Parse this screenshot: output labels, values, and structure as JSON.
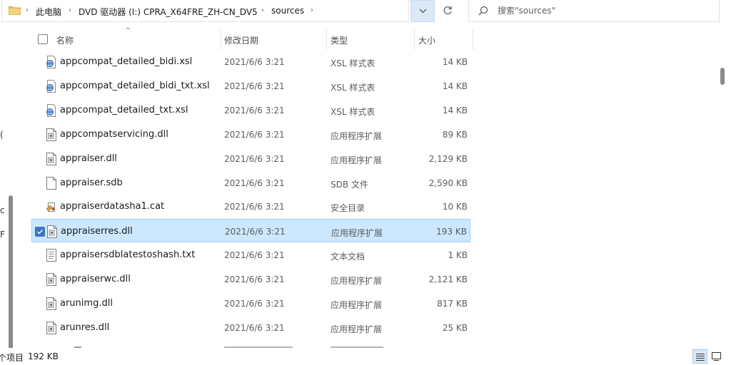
{
  "breadcrumb": {
    "items": [
      "此电脑",
      "DVD 驱动器 (I:) CPRA_X64FRE_ZH-CN_DV5",
      "sources"
    ]
  },
  "search": {
    "placeholder": "搜索\"sources\""
  },
  "nav_fragments": [
    "(",
    "c",
    "F"
  ],
  "columns": {
    "name": "名称",
    "date": "修改日期",
    "type": "类型",
    "size": "大小"
  },
  "files": [
    {
      "name": "appcompat_detailed_bidi.xsl",
      "date": "2021/6/6 3:21",
      "type": "XSL 样式表",
      "size": "14 KB",
      "icon": "xsl-file-icon",
      "selected": false
    },
    {
      "name": "appcompat_detailed_bidi_txt.xsl",
      "date": "2021/6/6 3:21",
      "type": "XSL 样式表",
      "size": "14 KB",
      "icon": "xsl-file-icon",
      "selected": false
    },
    {
      "name": "appcompat_detailed_txt.xsl",
      "date": "2021/6/6 3:21",
      "type": "XSL 样式表",
      "size": "14 KB",
      "icon": "xsl-file-icon",
      "selected": false
    },
    {
      "name": "appcompatservicing.dll",
      "date": "2021/6/6 3:21",
      "type": "应用程序扩展",
      "size": "89 KB",
      "icon": "dll-file-icon",
      "selected": false
    },
    {
      "name": "appraiser.dll",
      "date": "2021/6/6 3:21",
      "type": "应用程序扩展",
      "size": "2,129 KB",
      "icon": "dll-file-icon",
      "selected": false
    },
    {
      "name": "appraiser.sdb",
      "date": "2021/6/6 3:21",
      "type": "SDB 文件",
      "size": "2,590 KB",
      "icon": "blank-file-icon",
      "selected": false
    },
    {
      "name": "appraiserdatasha1.cat",
      "date": "2021/6/6 3:21",
      "type": "安全目录",
      "size": "10 KB",
      "icon": "catalog-file-icon",
      "selected": false
    },
    {
      "name": "appraiserres.dll",
      "date": "2021/6/6 3:21",
      "type": "应用程序扩展",
      "size": "193 KB",
      "icon": "dll-file-icon",
      "selected": true
    },
    {
      "name": "appraisersdblatestoshash.txt",
      "date": "2021/6/6 3:21",
      "type": "文本文档",
      "size": "1 KB",
      "icon": "text-file-icon",
      "selected": false
    },
    {
      "name": "appraiserwc.dll",
      "date": "2021/6/6 3:21",
      "type": "应用程序扩展",
      "size": "2,121 KB",
      "icon": "dll-file-icon",
      "selected": false
    },
    {
      "name": "arunimg.dll",
      "date": "2021/6/6 3:21",
      "type": "应用程序扩展",
      "size": "817 KB",
      "icon": "dll-file-icon",
      "selected": false
    },
    {
      "name": "arunres.dll",
      "date": "2021/6/6 3:21",
      "type": "应用程序扩展",
      "size": "25 KB",
      "icon": "dll-file-icon",
      "selected": false
    }
  ],
  "status": {
    "item_count": "个项目",
    "selected_size": "192 KB"
  },
  "colors": {
    "selection_fill": "#cce8ff",
    "selection_border": "#99d1ff",
    "checkbox_accent": "#3a77c0"
  }
}
